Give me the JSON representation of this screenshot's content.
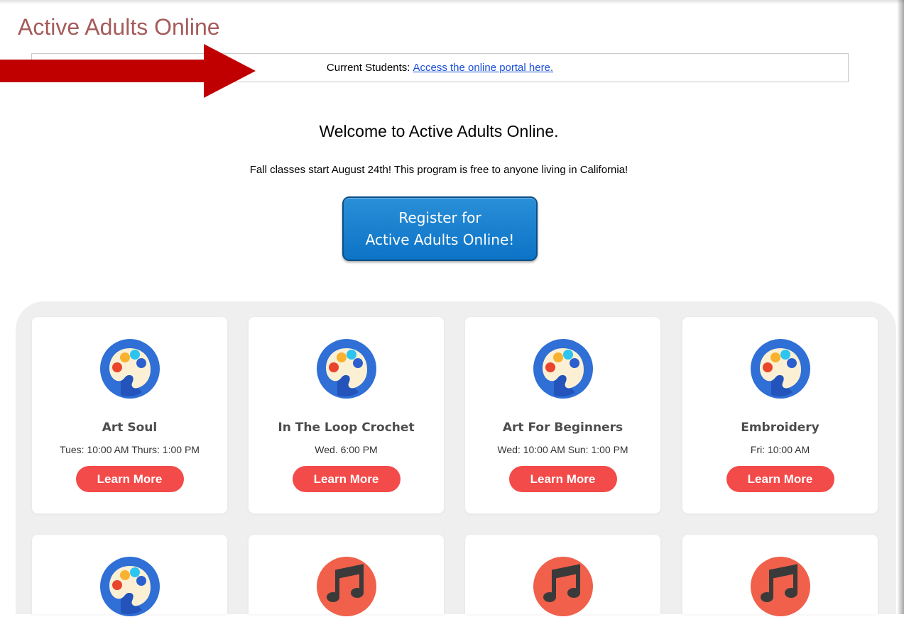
{
  "site_title": "Active Adults Online",
  "notice": {
    "label": "Current Students:",
    "link_text": "Access the online portal here."
  },
  "welcome": {
    "heading": "Welcome to Active Adults Online.",
    "subtext": "Fall classes start August 24th! This program is free to anyone living in California!"
  },
  "register_button": {
    "line1": "Register for",
    "line2": "Active Adults Online!"
  },
  "colors": {
    "title": "#a65b5b",
    "link": "#1a4fd6",
    "register_button": "#1a7fd0",
    "learn_more": "#f34a4a",
    "arrow": "#c00000"
  },
  "cards": [
    {
      "icon": "palette-icon",
      "title": "Art Soul",
      "time": "Tues: 10:00 AM Thurs: 1:00 PM",
      "button": "Learn More"
    },
    {
      "icon": "palette-icon",
      "title": "In The Loop Crochet",
      "time": "Wed. 6:00 PM",
      "button": "Learn More"
    },
    {
      "icon": "palette-icon",
      "title": "Art For Beginners",
      "time": "Wed: 10:00 AM Sun: 1:00 PM",
      "button": "Learn More"
    },
    {
      "icon": "palette-icon",
      "title": "Embroidery",
      "time": "Fri: 10:00 AM",
      "button": "Learn More"
    }
  ],
  "cards_row2": [
    {
      "icon": "palette-icon"
    },
    {
      "icon": "music-note-icon"
    },
    {
      "icon": "music-note-icon"
    },
    {
      "icon": "music-note-icon"
    }
  ]
}
